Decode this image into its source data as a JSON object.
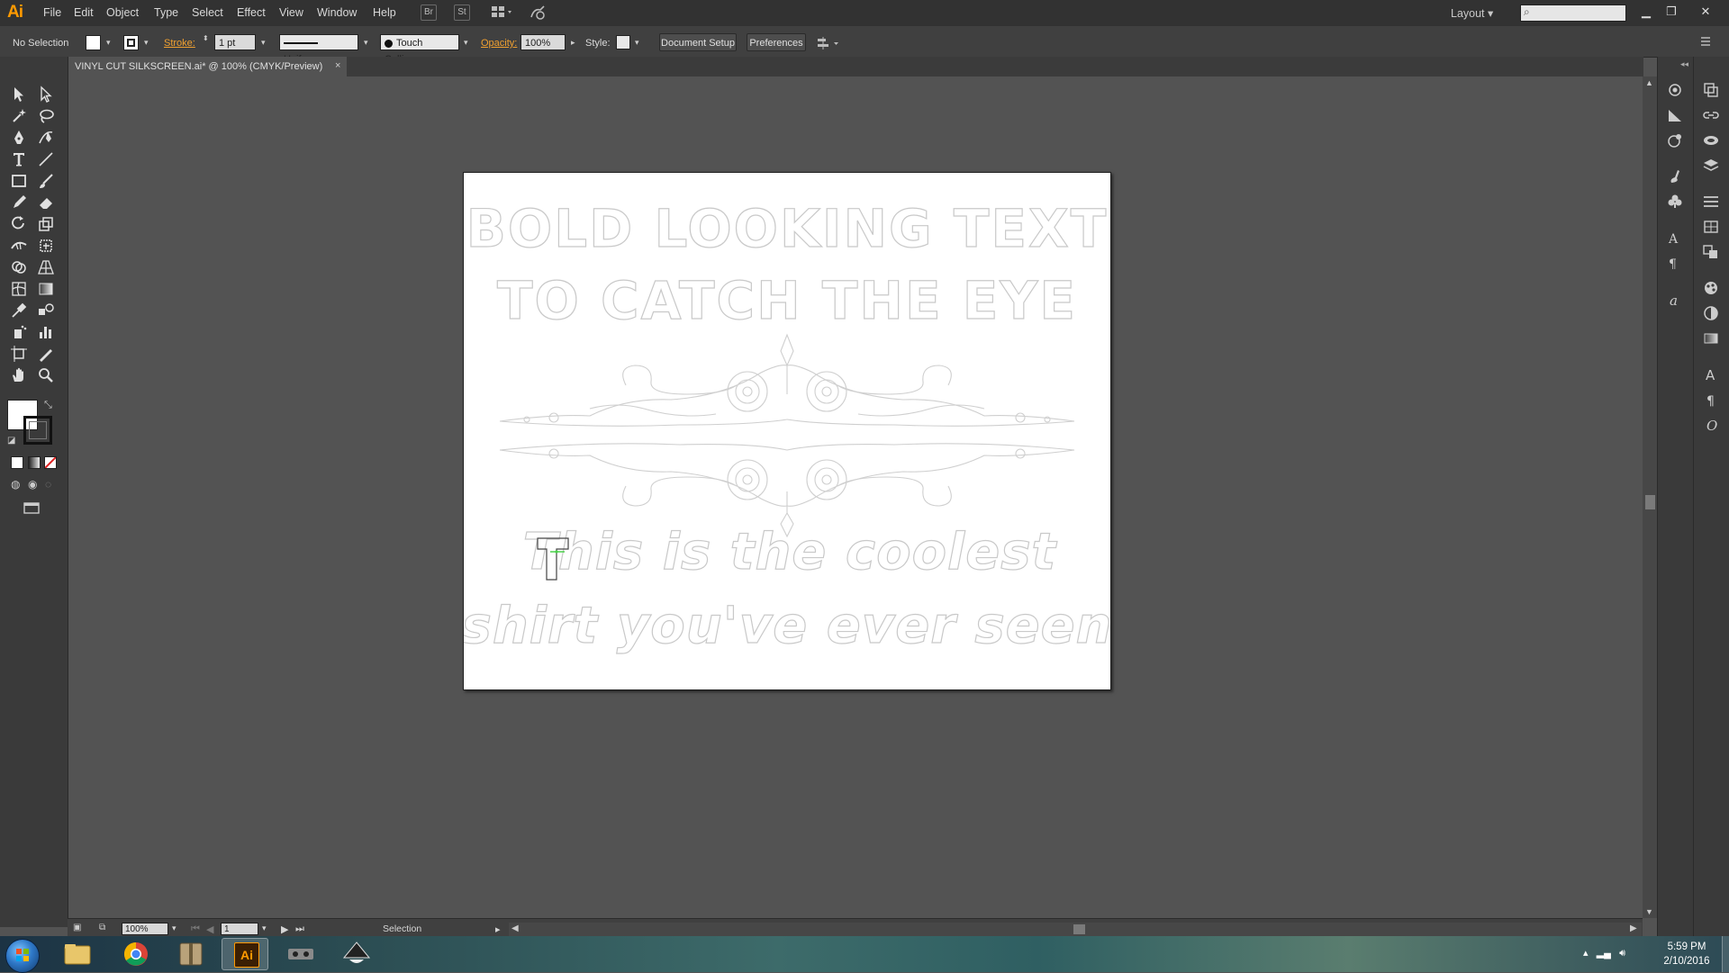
{
  "app": {
    "logo": "Ai",
    "menu": [
      "File",
      "Edit",
      "Object",
      "Type",
      "Select",
      "Effect",
      "View",
      "Window",
      "Help"
    ],
    "menubar_icons": {
      "bridge": "Br",
      "stock": "St"
    },
    "workspace": "Layout",
    "search_placeholder": ""
  },
  "control_bar": {
    "selection_status": "No Selection",
    "stroke_label": "Stroke:",
    "stroke_weight": "1 pt",
    "stroke_profile": "Uniform",
    "brush": "Touch Callig...",
    "opacity_label": "Opacity:",
    "opacity_value": "100%",
    "style_label": "Style:",
    "document_setup": "Document Setup",
    "preferences": "Preferences"
  },
  "document": {
    "tab_title": "VINYL CUT SILKSCREEN.ai* @ 100% (CMYK/Preview)",
    "tab_close": "×",
    "artwork": {
      "headline_line1": "BOLD LOOKING TEXT",
      "headline_line2": "TO CATCH THE EYE",
      "script_line1": "This is the coolest",
      "script_line2": "shirt you've ever seen"
    }
  },
  "status_bar": {
    "zoom": "100%",
    "artboard_number": "1",
    "current_tool": "Selection"
  },
  "taskbar": {
    "time": "5:59 PM",
    "date": "2/10/2016",
    "apps": [
      "windows-explorer",
      "google-chrome",
      "file-archive",
      "adobe-illustrator",
      "tools",
      "inkscape"
    ],
    "illustrator_label": "Ai"
  },
  "colors": {
    "accent_orange": "#ff9a00",
    "ui_dark": "#323232",
    "canvas_gray": "#535353",
    "fill_swatch": "#ffffff",
    "selection_highlight": "#4ad14a"
  }
}
